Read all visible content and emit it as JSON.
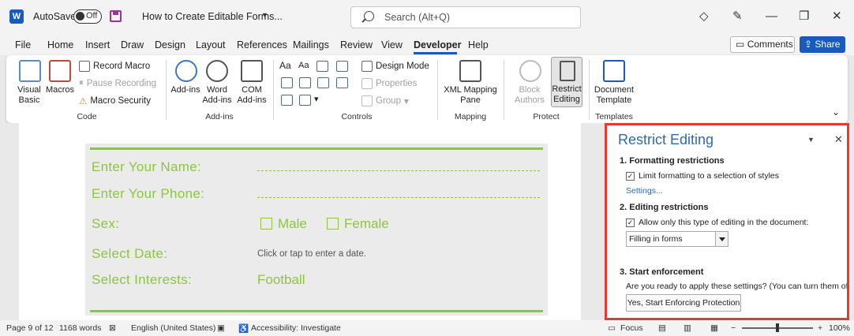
{
  "titlebar": {
    "autosave_label": "AutoSave",
    "autosave_state": "Off",
    "document_title": "How to Create Editable Forms...",
    "search_placeholder": "Search (Alt+Q)"
  },
  "menu": {
    "items": [
      "File",
      "Home",
      "Insert",
      "Draw",
      "Design",
      "Layout",
      "References",
      "Mailings",
      "Review",
      "View",
      "Developer",
      "Help"
    ],
    "active": "Developer",
    "comments_label": "Comments",
    "share_label": "Share"
  },
  "ribbon": {
    "code": {
      "group_label": "Code",
      "visual_basic": "Visual Basic",
      "macros": "Macros",
      "record_macro": "Record Macro",
      "pause_recording": "Pause Recording",
      "macro_security": "Macro Security"
    },
    "addins": {
      "group_label": "Add-ins",
      "addins": "Add-ins",
      "word_addins": "Word Add-ins",
      "com_addins": "COM Add-ins"
    },
    "controls": {
      "group_label": "Controls",
      "design_mode": "Design Mode",
      "properties": "Properties",
      "group": "Group"
    },
    "mapping": {
      "group_label": "Mapping",
      "xml_mapping_pane": "XML Mapping Pane"
    },
    "protect": {
      "group_label": "Protect",
      "block_authors": "Block Authors",
      "restrict_editing": "Restrict Editing"
    },
    "templates": {
      "group_label": "Templates",
      "document_template": "Document Template"
    }
  },
  "form": {
    "name_label": "Enter Your Name:",
    "phone_label": "Enter Your Phone:",
    "sex_label": "Sex:",
    "male": "Male",
    "female": "Female",
    "date_label": "Select Date:",
    "date_placeholder": "Click or tap to enter a date.",
    "interests_label": "Select Interests:",
    "interests_value": "Football"
  },
  "pane": {
    "title": "Restrict Editing",
    "section1_heading": "1. Formatting restrictions",
    "section1_option": "Limit formatting to a selection of styles",
    "section1_option_checked": true,
    "settings_link": "Settings...",
    "section2_heading": "2. Editing restrictions",
    "section2_option": "Allow only this type of editing in the document:",
    "section2_option_checked": true,
    "editing_type": "Filling in forms",
    "section3_heading": "3. Start enforcement",
    "section3_text": "Are you ready to apply these settings? (You can turn them off later",
    "enforce_button": "Yes, Start Enforcing Protection",
    "highlight_color": "#e53935"
  },
  "statusbar": {
    "page": "Page 9 of 12",
    "words": "1168 words",
    "language": "English (United States)",
    "accessibility": "Accessibility: Investigate",
    "focus": "Focus",
    "zoom": "100%"
  },
  "colors": {
    "accent": "#185abd",
    "form_green": "#8cc63f",
    "pane_title": "#2e6ab1"
  }
}
